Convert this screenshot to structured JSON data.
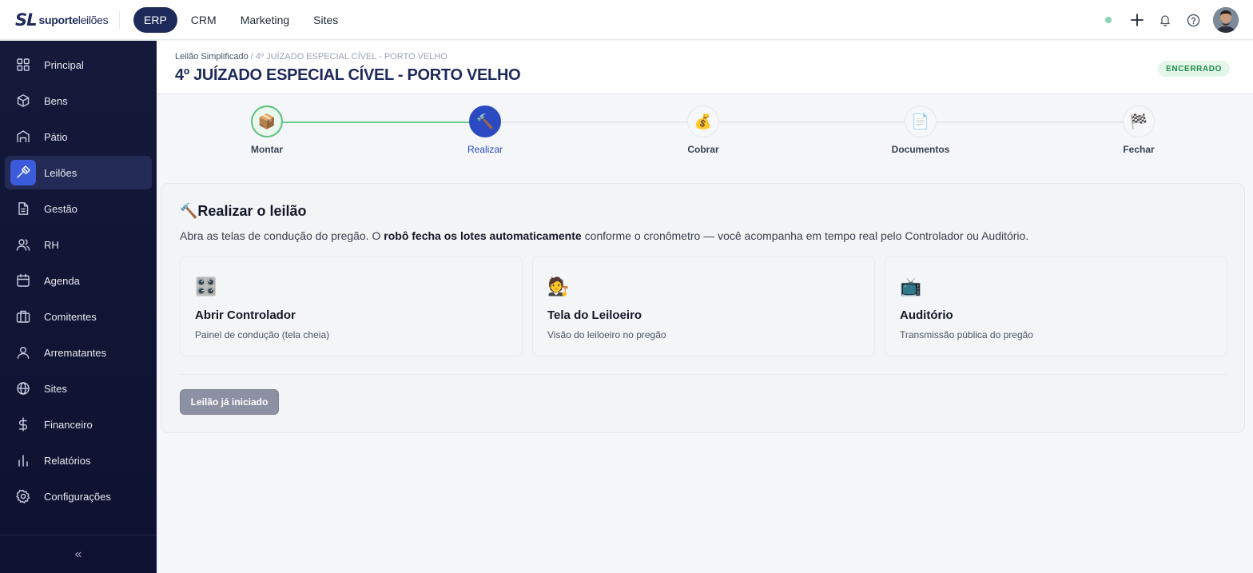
{
  "brand": {
    "mark": "SL",
    "name_bold": "suporte",
    "name_light": "leilões"
  },
  "topnav": [
    {
      "label": "ERP",
      "active": true
    },
    {
      "label": "CRM",
      "active": false
    },
    {
      "label": "Marketing",
      "active": false
    },
    {
      "label": "Sites",
      "active": false
    }
  ],
  "topbar_icons": [
    "status-dot",
    "plus-icon",
    "bell-icon",
    "help-icon",
    "user-avatar"
  ],
  "sidebar": {
    "items": [
      {
        "label": "Principal",
        "icon": "grid-icon"
      },
      {
        "label": "Bens",
        "icon": "box-icon"
      },
      {
        "label": "Pátio",
        "icon": "warehouse-icon"
      },
      {
        "label": "Leilões",
        "icon": "gavel-icon",
        "active": true
      },
      {
        "label": "Gestão",
        "icon": "document-icon"
      },
      {
        "label": "RH",
        "icon": "users-icon"
      },
      {
        "label": "Agenda",
        "icon": "calendar-icon"
      },
      {
        "label": "Comitentes",
        "icon": "building-icon"
      },
      {
        "label": "Arrematantes",
        "icon": "user-icon"
      },
      {
        "label": "Sites",
        "icon": "globe-icon"
      },
      {
        "label": "Financeiro",
        "icon": "dollar-icon"
      },
      {
        "label": "Relatórios",
        "icon": "bar-chart-icon"
      },
      {
        "label": "Configurações",
        "icon": "gear-icon"
      }
    ],
    "collapse_label": "«"
  },
  "header": {
    "breadcrumb_link": "Leilão Simplificado",
    "breadcrumb_sep": "/",
    "breadcrumb_current": "4º JUÍZADO ESPECIAL CÍVEL - PORTO VELHO",
    "title": "4º JUÍZADO ESPECIAL CÍVEL - PORTO VELHO",
    "status": "ENCERRADO"
  },
  "steps": [
    {
      "label": "Montar",
      "icon": "📦",
      "state": "done"
    },
    {
      "label": "Realizar",
      "icon": "🔨",
      "state": "current"
    },
    {
      "label": "Cobrar",
      "icon": "💰",
      "state": "pending"
    },
    {
      "label": "Documentos",
      "icon": "📄",
      "state": "pending"
    },
    {
      "label": "Fechar",
      "icon": "🏁",
      "state": "pending"
    }
  ],
  "main": {
    "title_icon": "🔨",
    "title": "Realizar o leilão",
    "desc_pre": "Abra as telas de condução do pregão. O ",
    "desc_bold": "robô fecha os lotes automaticamente",
    "desc_post": " conforme o cronômetro — você acompanha em tempo real pelo Controlador ou Auditório.",
    "options": [
      {
        "icon": "🎛️",
        "title": "Abrir Controlador",
        "subtitle": "Painel de condução (tela cheia)"
      },
      {
        "icon": "🧑‍⚖️",
        "title": "Tela do Leiloeiro",
        "subtitle": "Visão do leiloeiro no pregão"
      },
      {
        "icon": "📺",
        "title": "Auditório",
        "subtitle": "Transmissão pública do pregão"
      }
    ],
    "button_label": "Leilão já iniciado"
  },
  "colors": {
    "navy": "#1e2a5a",
    "sidebar_bg": "#15193a",
    "active_blue": "#3b5bdb",
    "step_current": "#2b4ac1",
    "step_done": "#5cc17c",
    "badge_green": "#1f8a4c"
  }
}
